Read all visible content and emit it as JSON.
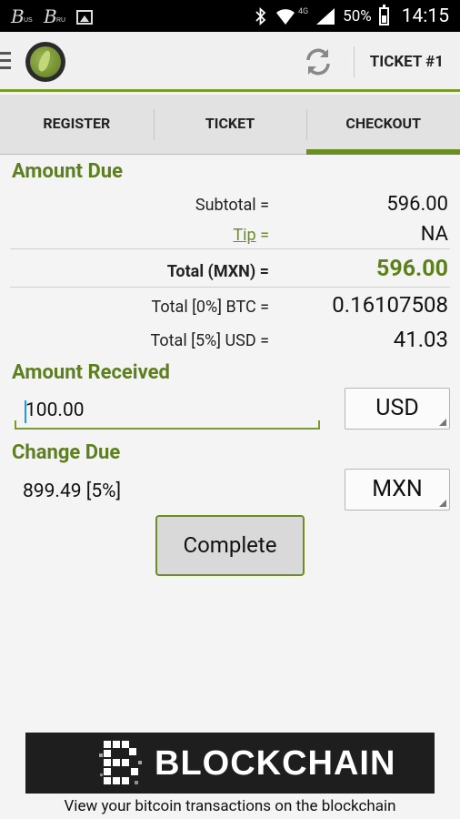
{
  "status_bar": {
    "left_icons": [
      {
        "name": "bitcoin-us-notification-icon",
        "sub": "US"
      },
      {
        "name": "bitcoin-ru-notification-icon",
        "sub": "RU"
      },
      {
        "name": "image-notification-icon"
      }
    ],
    "network": "4G",
    "battery": "50%",
    "time": "14:15"
  },
  "action_bar": {
    "title": "TICKET #1",
    "icons": [
      "hamburger-icon",
      "app-logo",
      "refresh-icon"
    ]
  },
  "tabs": [
    {
      "label": "REGISTER",
      "active": false
    },
    {
      "label": "TICKET",
      "active": false
    },
    {
      "label": "CHECKOUT",
      "active": true
    }
  ],
  "amount_due": {
    "heading": "Amount Due",
    "subtotal_label": "Subtotal =",
    "subtotal_value": "596.00",
    "tip_label": "Tip",
    "tip_eq": " =",
    "tip_value": "NA",
    "total_label": "Total (MXN) =",
    "total_value": "596.00",
    "btc_label": "Total [0%] BTC =",
    "btc_value": "0.16107508",
    "usd_label": "Total [5%] USD =",
    "usd_value": "41.03"
  },
  "amount_received": {
    "heading": "Amount Received",
    "value": "100.00",
    "currency": "USD"
  },
  "change_due": {
    "heading": "Change Due",
    "value": "899.49 [5%]",
    "currency": "MXN"
  },
  "complete_button": "Complete",
  "banner": {
    "brand": "BLOCKCHAIN",
    "caption": "View your bitcoin transactions on the blockchain"
  },
  "colors": {
    "accent": "#6b8e23",
    "heading_green": "#5e7f1e",
    "cursor": "#2196f3"
  }
}
